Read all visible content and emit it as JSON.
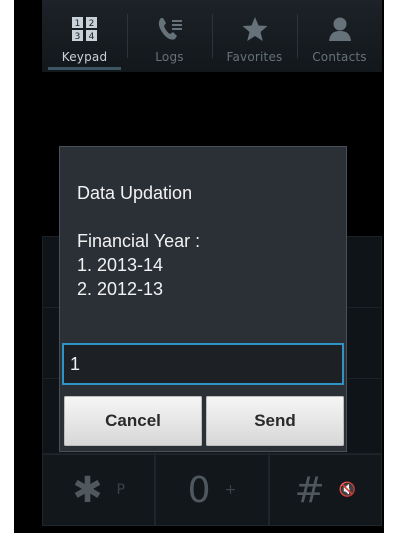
{
  "tabs": [
    {
      "label": "Keypad",
      "icon": "keypad-icon",
      "active": true
    },
    {
      "label": "Logs",
      "icon": "call-log-icon",
      "active": false
    },
    {
      "label": "Favorites",
      "icon": "star-icon",
      "active": false
    },
    {
      "label": "Contacts",
      "icon": "person-icon",
      "active": false
    }
  ],
  "keypad": {
    "last_row": [
      {
        "main": "✱",
        "sub": "P"
      },
      {
        "main": "0",
        "sub": "+"
      },
      {
        "main": "#",
        "sub": "🔇"
      }
    ]
  },
  "dialog": {
    "title": "Data Updation",
    "heading": "Financial Year :",
    "options": [
      "1. 2013-14",
      "2. 2012-13"
    ],
    "input_value": "1",
    "cancel_label": "Cancel",
    "send_label": "Send",
    "accent_color": "#2f93c6"
  }
}
